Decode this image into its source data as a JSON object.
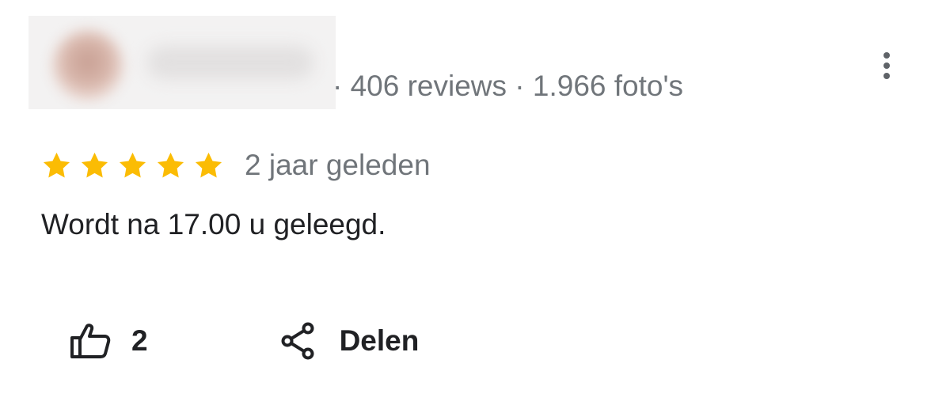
{
  "review": {
    "author_meta": "· 406 reviews · 1.966 foto's",
    "rating": 5,
    "rating_max": 5,
    "date": "2 jaar geleden",
    "text": "Wordt na 17.00 u geleegd."
  },
  "actions": {
    "like_count": "2",
    "share_label": "Delen"
  },
  "icons": {
    "more": "more-vert-icon",
    "star": "star-icon",
    "like": "thumb-up-icon",
    "share": "share-icon"
  },
  "colors": {
    "star": "#fbbc04",
    "meta_text": "#70757a",
    "body_text": "#202124"
  }
}
